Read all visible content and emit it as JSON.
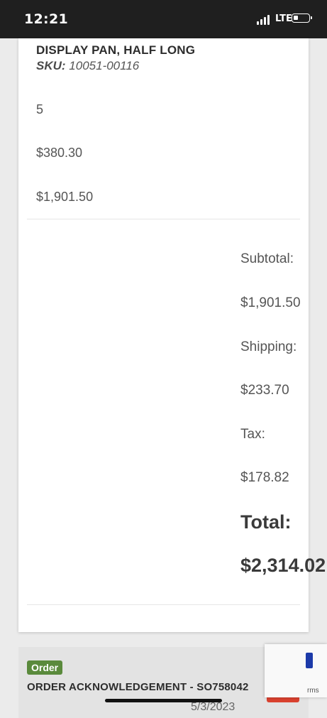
{
  "status": {
    "time": "12:21",
    "network": "LTE"
  },
  "item": {
    "name": "DISPLAY PAN, HALF LONG",
    "sku_label": "SKU:",
    "sku": "10051-00116",
    "quantity": "5",
    "unit_price": "$380.30",
    "line_total": "$1,901.50"
  },
  "totals": {
    "subtotal_label": "Subtotal:",
    "subtotal": "$1,901.50",
    "shipping_label": "Shipping:",
    "shipping": "$233.70",
    "tax_label": "Tax:",
    "tax": "$178.82",
    "total_label": "Total:",
    "total": "$2,314.02"
  },
  "order": {
    "badge": "Order",
    "title": "ORDER ACKNOWLEDGEMENT - SO758042",
    "date": "5/3/2023"
  },
  "recaptcha": {
    "terms": "rms"
  },
  "colors": {
    "badge": "#5a8a3c",
    "print_button": "#d9412f",
    "status_bar": "#1f1f1f"
  }
}
